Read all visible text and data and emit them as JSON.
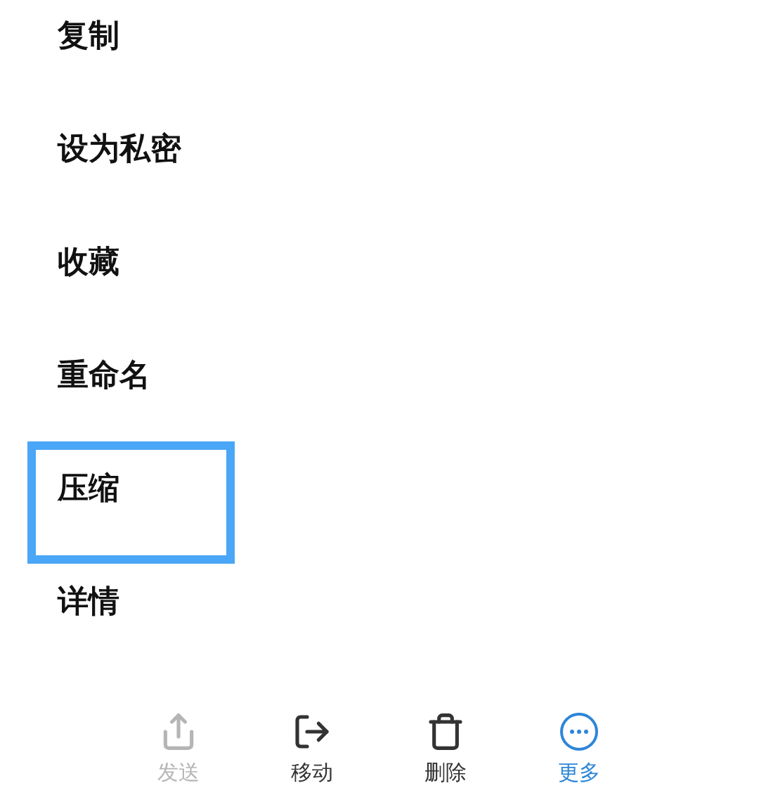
{
  "menu": [
    {
      "label": "复制",
      "highlighted": false
    },
    {
      "label": "设为私密",
      "highlighted": false
    },
    {
      "label": "收藏",
      "highlighted": false
    },
    {
      "label": "重命名",
      "highlighted": false
    },
    {
      "label": "压缩",
      "highlighted": true
    },
    {
      "label": "详情",
      "highlighted": false
    }
  ],
  "toolbar": [
    {
      "kind": "send",
      "label": "发送",
      "disabled": true,
      "selected": false
    },
    {
      "kind": "move",
      "label": "移动",
      "disabled": false,
      "selected": false
    },
    {
      "kind": "delete",
      "label": "删除",
      "disabled": false,
      "selected": false
    },
    {
      "kind": "more",
      "label": "更多",
      "disabled": false,
      "selected": true
    }
  ]
}
